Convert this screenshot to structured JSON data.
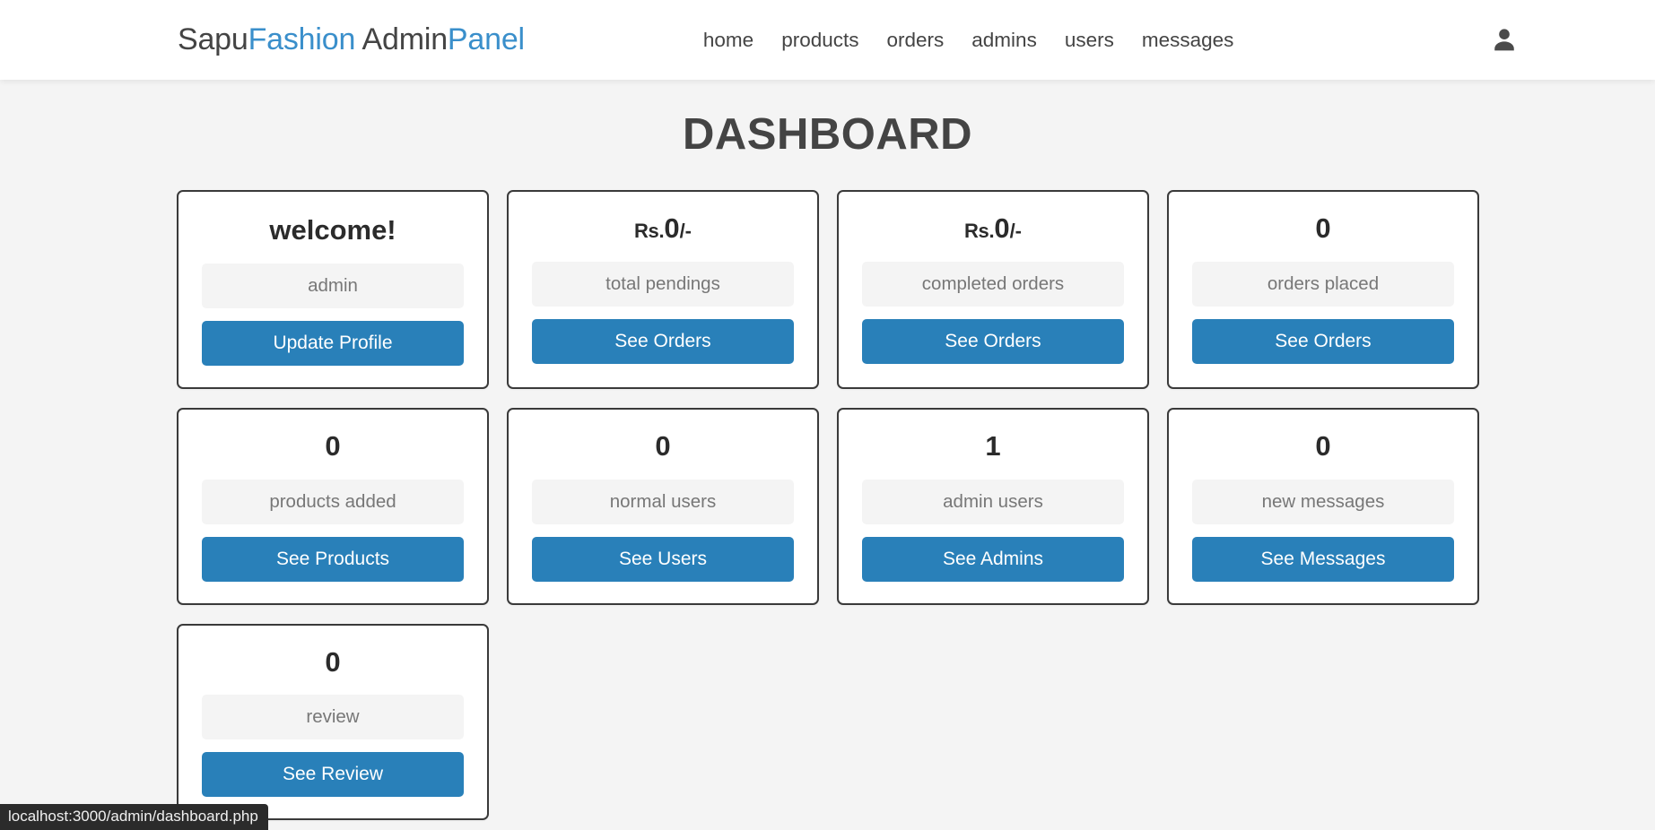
{
  "header": {
    "logo": {
      "part1": "Sapu",
      "part2": "Fashion",
      "part3": " Admin",
      "part4": "Panel"
    },
    "nav": [
      {
        "label": "home"
      },
      {
        "label": "products"
      },
      {
        "label": "orders"
      },
      {
        "label": "admins"
      },
      {
        "label": "users"
      },
      {
        "label": "messages"
      }
    ],
    "profile_icon": "user-icon"
  },
  "main": {
    "title": "DASHBOARD",
    "cards": [
      {
        "id": "welcome",
        "currency": "",
        "value": "welcome!",
        "suffix": "",
        "label": "admin",
        "button": "Update Profile"
      },
      {
        "id": "total-pendings",
        "currency": "Rs.",
        "value": "0",
        "suffix": "/-",
        "label": "total pendings",
        "button": "See Orders"
      },
      {
        "id": "completed-orders",
        "currency": "Rs.",
        "value": "0",
        "suffix": "/-",
        "label": "completed orders",
        "button": "See Orders"
      },
      {
        "id": "orders-placed",
        "currency": "",
        "value": "0",
        "suffix": "",
        "label": "orders placed",
        "button": "See Orders"
      },
      {
        "id": "products-added",
        "currency": "",
        "value": "0",
        "suffix": "",
        "label": "products added",
        "button": "See Products"
      },
      {
        "id": "normal-users",
        "currency": "",
        "value": "0",
        "suffix": "",
        "label": "normal users",
        "button": "See Users"
      },
      {
        "id": "admin-users",
        "currency": "",
        "value": "1",
        "suffix": "",
        "label": "admin users",
        "button": "See Admins"
      },
      {
        "id": "new-messages",
        "currency": "",
        "value": "0",
        "suffix": "",
        "label": "new messages",
        "button": "See Messages"
      },
      {
        "id": "review",
        "currency": "",
        "value": "0",
        "suffix": "",
        "label": "review",
        "button": "See Review"
      }
    ]
  },
  "status_bar": {
    "url": "localhost:3000/admin/dashboard.php"
  },
  "colors": {
    "accent_blue": "#3a8fcb",
    "button_blue": "#2980b9",
    "page_background": "#f4f4f4",
    "card_border": "#3a3a3a",
    "text_dark": "#444444",
    "label_text": "#777777",
    "status_bar_background": "#2b2b2b"
  }
}
